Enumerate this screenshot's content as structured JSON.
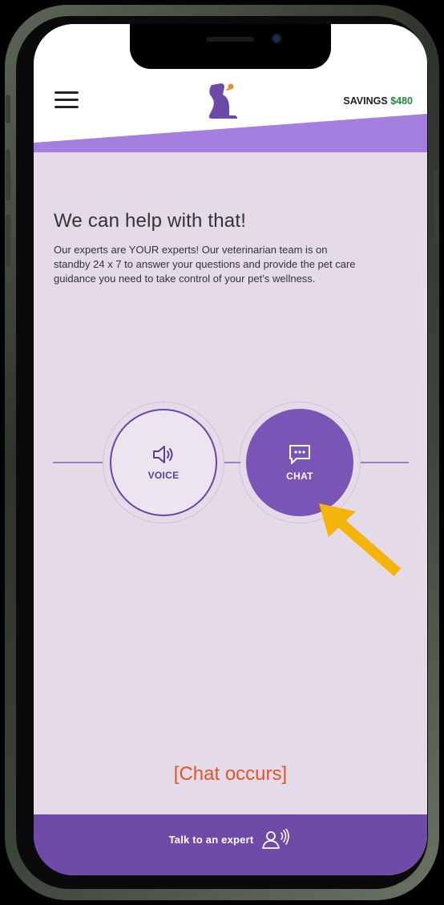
{
  "header": {
    "savings_label": "SAVINGS",
    "savings_amount": "$480"
  },
  "main": {
    "title": "We can help with that!",
    "description": "Our experts are YOUR experts! Our veterinarian team is on standby 24 x 7 to answer your questions and provide the pet care guidance you need to take control of your pet’s wellness."
  },
  "options": {
    "voice_label": "VOICE",
    "chat_label": "CHAT"
  },
  "annotation": "[Chat occurs]",
  "footer": {
    "label": "Talk to an expert"
  },
  "icons": [
    "menu-icon",
    "dog-logo-icon",
    "speaker-icon",
    "chat-bubble-icon",
    "person-voice-icon",
    "arrow-pointer-icon"
  ],
  "colors": {
    "accent_purple": "#7a55b5",
    "header_stripe": "#a57fe0",
    "screen_bg": "#e5dbe8",
    "savings_green": "#1f8a3a",
    "annotation_orange": "#e0552a",
    "arrow_yellow": "#f5b40c",
    "footer_bg": "#6f4aa7"
  }
}
